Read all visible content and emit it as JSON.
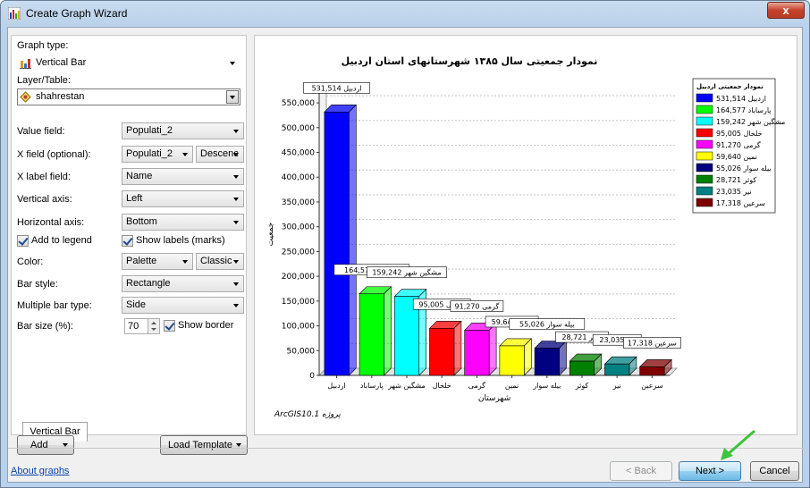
{
  "window": {
    "title": "Create Graph Wizard",
    "close_glyph": "x"
  },
  "left": {
    "graph_type_label": "Graph type:",
    "graph_type_value": "Vertical Bar",
    "layer_label": "Layer/Table:",
    "layer_value": "shahrestan",
    "value_field_label": "Value field:",
    "value_field_value": "Populati_2",
    "x_field_label": "X field (optional):",
    "x_field_value": "Populati_2",
    "x_field_sort": "Descenc",
    "x_label_field_label": "X label field:",
    "x_label_field_value": "Name",
    "vertical_axis_label": "Vertical axis:",
    "vertical_axis_value": "Left",
    "horizontal_axis_label": "Horizontal axis:",
    "horizontal_axis_value": "Bottom",
    "add_to_legend": "Add to legend",
    "show_labels": "Show labels (marks)",
    "color_label": "Color:",
    "color_value": "Palette",
    "color_scheme": "Classic",
    "bar_style_label": "Bar style:",
    "bar_style_value": "Rectangle",
    "multiple_bar_label": "Multiple bar type:",
    "multiple_bar_value": "Side",
    "bar_size_label": "Bar size (%):",
    "bar_size_value": "70",
    "show_border": "Show border",
    "tab_label": "Vertical Bar"
  },
  "buttons": {
    "add": "Add",
    "load_template": "Load Template",
    "back": "< Back",
    "next": "Next >",
    "cancel": "Cancel"
  },
  "footer": {
    "about_graphs": "About graphs"
  },
  "colors": {
    "accent": "#3c7fb1",
    "arrow": "#3cc43c"
  },
  "chart_data": {
    "type": "bar",
    "title": "نمودار جمعیتی سال ۱۳۸۵ شهرستانهای استان اردبیل",
    "xlabel": "شهرستان",
    "ylabel": "جمعیت",
    "ylim": [
      0,
      570000
    ],
    "yticks": [
      "0",
      "50,000",
      "100,000",
      "150,000",
      "200,000",
      "250,000",
      "300,000",
      "350,000",
      "400,000",
      "450,000",
      "500,000",
      "550,000"
    ],
    "grid": true,
    "footer_note": "ArcGIS10.1 پروژه",
    "legend_title": "نمودار جمعیتی اردبیل",
    "legend_position": "top-right",
    "categories": [
      "اردبیل",
      "پارساباد",
      "مشگین شهر",
      "خلخال",
      "گرمی",
      "نمین",
      "بیله سوار",
      "کوثر",
      "نیر",
      "سرعین"
    ],
    "values": [
      531514,
      164577,
      159242,
      95005,
      91270,
      59640,
      55026,
      28721,
      23035,
      17318
    ],
    "value_labels": [
      "531,514",
      "164,577",
      "159,242",
      "95,005",
      "91,270",
      "59,640",
      "55,026",
      "28,721",
      "23,035",
      "17,318"
    ],
    "colors": [
      "#0000ff",
      "#00ff00",
      "#00ffff",
      "#ff0000",
      "#ff00ff",
      "#ffff00",
      "#000080",
      "#008000",
      "#008080",
      "#800000"
    ]
  }
}
